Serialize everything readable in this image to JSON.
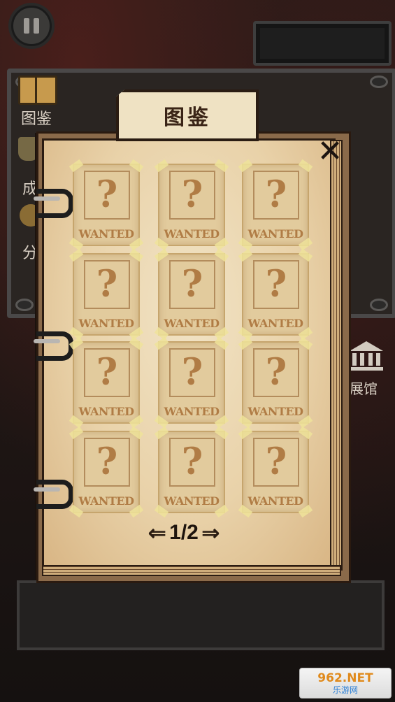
{
  "sidebar": {
    "items": [
      {
        "label": "图鉴"
      },
      {
        "label": "成"
      },
      {
        "label": "分"
      }
    ],
    "museum_label": "展馆"
  },
  "book": {
    "title": "图鉴",
    "close_symbol": "✕",
    "cards": [
      {
        "mark": "?",
        "caption": "WANTED"
      },
      {
        "mark": "?",
        "caption": "WANTED"
      },
      {
        "mark": "?",
        "caption": "WANTED"
      },
      {
        "mark": "?",
        "caption": "WANTED"
      },
      {
        "mark": "?",
        "caption": "WANTED"
      },
      {
        "mark": "?",
        "caption": "WANTED"
      },
      {
        "mark": "?",
        "caption": "WANTED"
      },
      {
        "mark": "?",
        "caption": "WANTED"
      },
      {
        "mark": "?",
        "caption": "WANTED"
      },
      {
        "mark": "?",
        "caption": "WANTED"
      },
      {
        "mark": "?",
        "caption": "WANTED"
      },
      {
        "mark": "?",
        "caption": "WANTED"
      }
    ],
    "pager": {
      "prev": "⇐",
      "label": "1/2",
      "next": "⇒"
    }
  },
  "watermark": {
    "top": "962.NET",
    "bottom": "乐游网"
  }
}
